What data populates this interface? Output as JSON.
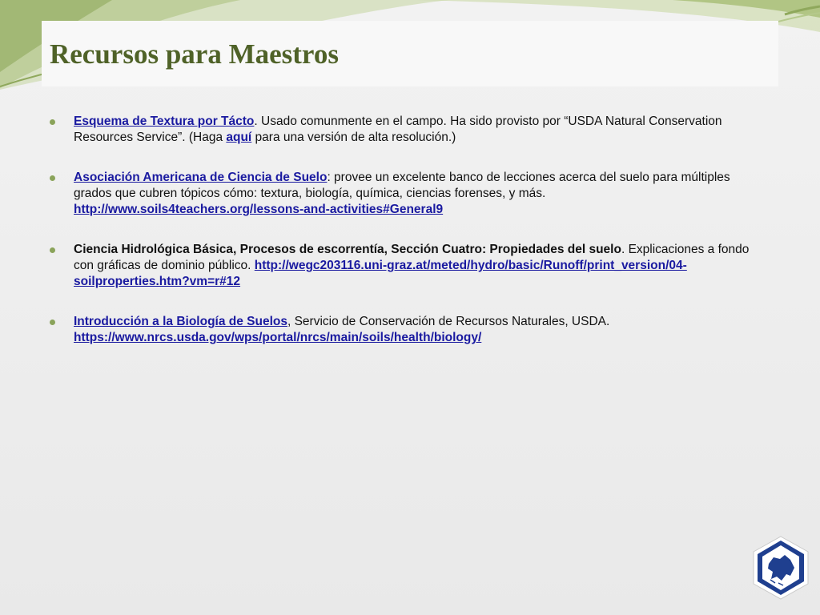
{
  "slide": {
    "title": "Recursos para Maestros",
    "colors": {
      "title": "#4f6228",
      "bullet": "#8aa35a",
      "link": "#1a1aa0",
      "accent_green": "#8aa35a",
      "logo_blue": "#1f3f8f"
    },
    "logo_icon": "alaska-seal-icon"
  },
  "items": [
    {
      "link1": "Esquema de Textura por Tácto",
      "text1": ". Usado comunmente en el campo. Ha sido provisto por “USDA Natural Conservation Resources Service”. (Haga ",
      "link2": "aquí",
      "text2": " para una versión de alta resolución.)"
    },
    {
      "link1": "Asociación Americana de Ciencia de Suelo",
      "text1": ": provee un excelente banco de lecciones acerca del suelo para múltiples grados que cubren tópicos cómo: textura, biología, química, ciencias forenses, y más. ",
      "link2": "http://www.soils4teachers.org/lessons-and-activities#General9"
    },
    {
      "bold": "Ciencia Hidrológica Básica, Procesos de escorrentía, Sección Cuatro: Propiedades del suelo",
      "text1": ". Explicaciones a fondo con gráficas de dominio público. ",
      "link1": "http://wegc203116.uni-graz.at/meted/hydro/basic/Runoff/print_version/04-soilproperties.htm?vm=r#12"
    },
    {
      "link1": "Introducción a la Biología de Suelos",
      "text1": ", Servicio de Conservación de Recursos Naturales, USDA. ",
      "link2": "https://www.nrcs.usda.gov/wps/portal/nrcs/main/soils/health/biology/"
    }
  ]
}
